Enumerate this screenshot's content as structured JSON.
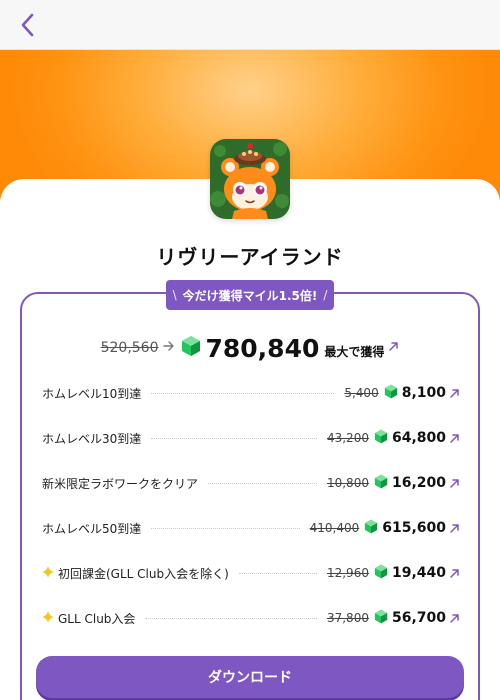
{
  "app": {
    "title": "リヴリーアイランド"
  },
  "promo": {
    "badge_text": "今だけ獲得マイル1.5倍!",
    "total_old": "520,560",
    "total_new": "780,840",
    "total_suffix": "最大で獲得"
  },
  "rewards": [
    {
      "label": "ホムレベル10到達",
      "old": "5,400",
      "new": "8,100",
      "icon": ""
    },
    {
      "label": "ホムレベル30到達",
      "old": "43,200",
      "new": "64,800",
      "icon": ""
    },
    {
      "label": "新米限定ラボワークをクリア",
      "old": "10,800",
      "new": "16,200",
      "icon": ""
    },
    {
      "label": "ホムレベル50到達",
      "old": "410,400",
      "new": "615,600",
      "icon": ""
    },
    {
      "label": "初回課金(GLL Club入会を除く)",
      "old": "12,960",
      "new": "19,440",
      "icon": "sparkle-icon"
    },
    {
      "label": "GLL Club入会",
      "old": "37,800",
      "new": "56,700",
      "icon": "sparkle-icon"
    }
  ],
  "actions": {
    "download_label": "ダウンロード"
  },
  "colors": {
    "accent": "#7e57c2",
    "hero_orange": "#ff9312",
    "gem_green": "#22c55e",
    "sparkle_yellow": "#f5c518"
  }
}
